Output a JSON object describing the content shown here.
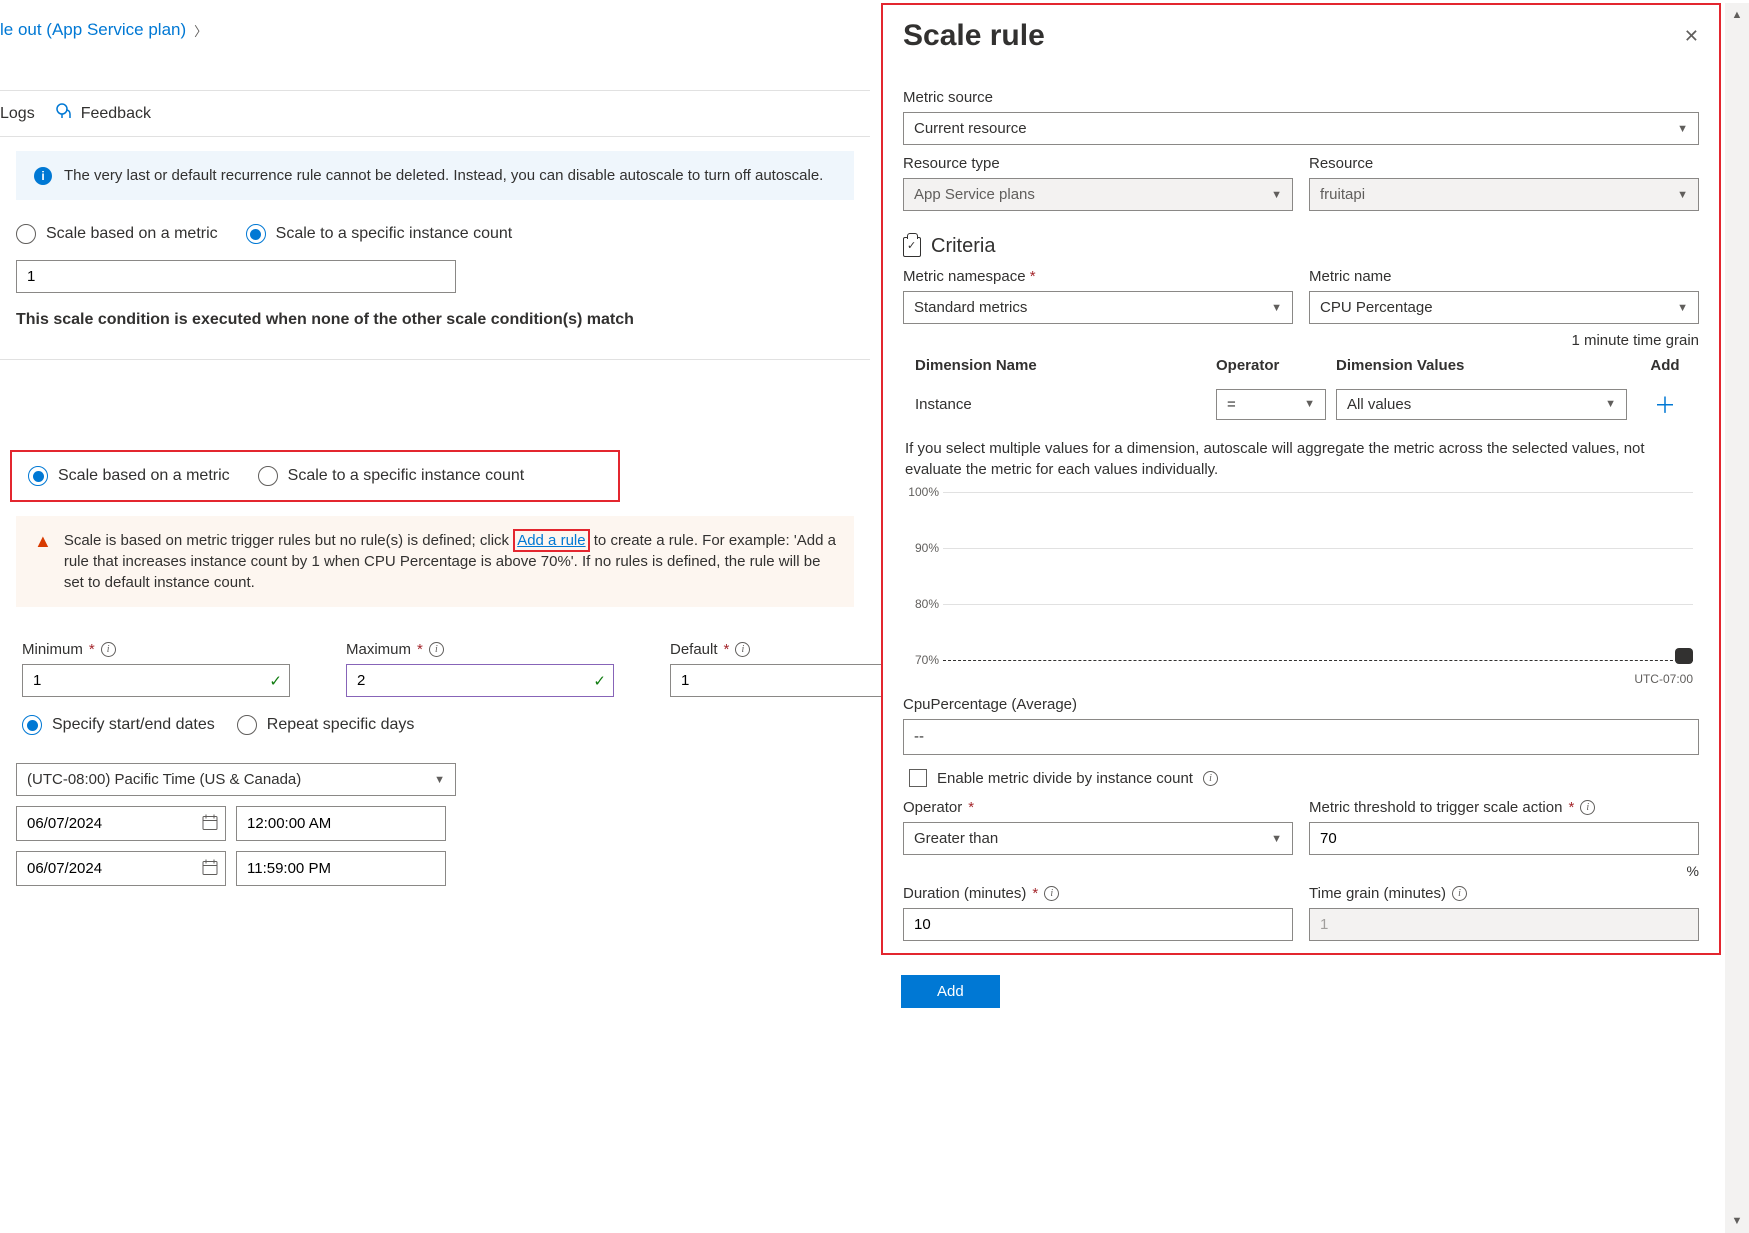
{
  "breadcrumb": {
    "text": "le out (App Service plan)"
  },
  "toolbar": {
    "logs": "Logs",
    "feedback": "Feedback"
  },
  "info_msg": "The very last or default recurrence rule cannot be deleted. Instead, you can disable autoscale to turn off autoscale.",
  "mode_opts": {
    "metric": "Scale based on a metric",
    "count": "Scale to a specific instance count"
  },
  "instance_count_value": "1",
  "exec_note": "This scale condition is executed when none of the other scale condition(s) match",
  "warn_msg": {
    "pre": "Scale is based on metric trigger rules but no rule(s) is defined; click ",
    "link": "Add a rule",
    "post": " to create a rule. For example: 'Add a rule that increases instance count by 1 when CPU Percentage is above 70%'. If no rules is defined, the rule will be set to default instance count."
  },
  "limits": {
    "minimum": {
      "label": "Minimum",
      "value": "1"
    },
    "maximum": {
      "label": "Maximum",
      "value": "2"
    },
    "default": {
      "label": "Default",
      "value": "1"
    }
  },
  "schedule": {
    "start_end": "Specify start/end dates",
    "repeat": "Repeat specific days"
  },
  "timezone": "(UTC-08:00) Pacific Time (US & Canada)",
  "dates": {
    "start_date": "06/07/2024",
    "start_time": "12:00:00 AM",
    "end_date": "06/07/2024",
    "end_time": "11:59:00 PM"
  },
  "panel": {
    "title": "Scale rule",
    "metric_source_label": "Metric source",
    "metric_source_value": "Current resource",
    "resource_type_label": "Resource type",
    "resource_type_value": "App Service plans",
    "resource_label": "Resource",
    "resource_value": "fruitapi",
    "criteria": "Criteria",
    "metric_namespace_label": "Metric namespace",
    "metric_namespace_value": "Standard metrics",
    "metric_name_label": "Metric name",
    "metric_name_value": "CPU Percentage",
    "time_grain_note": "1 minute time grain",
    "dim_head": {
      "name": "Dimension Name",
      "op": "Operator",
      "vals": "Dimension Values",
      "add": "Add"
    },
    "dim_row": {
      "name": "Instance",
      "op": "=",
      "vals": "All values"
    },
    "multi_note": "If you select multiple values for a dimension, autoscale will aggregate the metric across the selected values, not evaluate the metric for each values individually.",
    "readout_label": "CpuPercentage (Average)",
    "readout_value": "--",
    "divide_label": "Enable metric divide by instance count",
    "operator_label": "Operator",
    "operator_value": "Greater than",
    "threshold_label": "Metric threshold to trigger scale action",
    "threshold_value": "70",
    "pct": "%",
    "duration_label": "Duration (minutes)",
    "duration_value": "10",
    "tg_label": "Time grain (minutes)",
    "tg_value": "1",
    "chart_xlabel": "UTC-07:00",
    "add_btn": "Add"
  },
  "chart_data": {
    "type": "line",
    "yticks": [
      "100%",
      "90%",
      "80%",
      "70%"
    ],
    "ylim": [
      70,
      100
    ],
    "threshold_line": 70,
    "title": "",
    "xlabel": "UTC-07:00",
    "ylabel": "",
    "series": []
  }
}
